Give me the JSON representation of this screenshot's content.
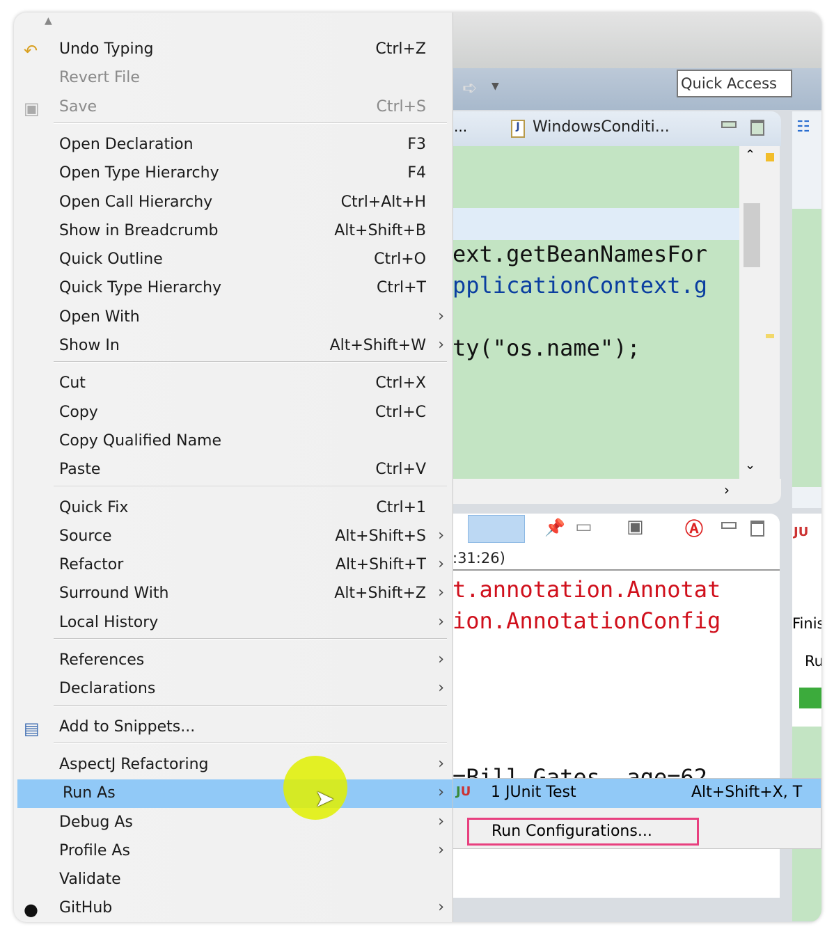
{
  "window": {
    "quick_access": "Quick Access",
    "editor_tab": "WindowsConditi...",
    "editor_tab_overflow": "..."
  },
  "editor": {
    "lines": [
      "ext.getBeanNamesFor",
      "pplicationContext.g",
      "ty(\"os.name\");"
    ]
  },
  "console": {
    "header": ":31:26)",
    "lines": [
      "t.annotation.Annotat",
      "ion.AnnotationConfig",
      "=Bill Gates, age=62"
    ]
  },
  "junit": {
    "finished": "Finis",
    "runs": "Ru",
    "status_color": "#3cab3c"
  },
  "menu": {
    "items": [
      {
        "label": "Undo Typing",
        "shortcut": "Ctrl+Z",
        "icon": "undo-icon"
      },
      {
        "label": "Revert File",
        "disabled": true
      },
      {
        "label": "Save",
        "shortcut": "Ctrl+S",
        "disabled": true,
        "icon": "save-icon",
        "sep_after": true
      },
      {
        "label": "Open Declaration",
        "shortcut": "F3"
      },
      {
        "label": "Open Type Hierarchy",
        "shortcut": "F4"
      },
      {
        "label": "Open Call Hierarchy",
        "shortcut": "Ctrl+Alt+H"
      },
      {
        "label": "Show in Breadcrumb",
        "shortcut": "Alt+Shift+B"
      },
      {
        "label": "Quick Outline",
        "shortcut": "Ctrl+O"
      },
      {
        "label": "Quick Type Hierarchy",
        "shortcut": "Ctrl+T"
      },
      {
        "label": "Open With",
        "submenu": true
      },
      {
        "label": "Show In",
        "shortcut": "Alt+Shift+W",
        "submenu": true,
        "sep_after": true
      },
      {
        "label": "Cut",
        "shortcut": "Ctrl+X"
      },
      {
        "label": "Copy",
        "shortcut": "Ctrl+C"
      },
      {
        "label": "Copy Qualified Name"
      },
      {
        "label": "Paste",
        "shortcut": "Ctrl+V",
        "sep_after": true
      },
      {
        "label": "Quick Fix",
        "shortcut": "Ctrl+1"
      },
      {
        "label": "Source",
        "shortcut": "Alt+Shift+S",
        "submenu": true
      },
      {
        "label": "Refactor",
        "shortcut": "Alt+Shift+T",
        "submenu": true
      },
      {
        "label": "Surround With",
        "shortcut": "Alt+Shift+Z",
        "submenu": true
      },
      {
        "label": "Local History",
        "submenu": true,
        "sep_after": true
      },
      {
        "label": "References",
        "submenu": true
      },
      {
        "label": "Declarations",
        "submenu": true,
        "sep_after": true
      },
      {
        "label": "Add to Snippets...",
        "icon": "snippets-icon",
        "sep_after": true
      },
      {
        "label": "AspectJ Refactoring",
        "submenu": true
      },
      {
        "label": "Run As",
        "submenu": true,
        "highlighted": true
      },
      {
        "label": "Debug As",
        "submenu": true
      },
      {
        "label": "Profile As",
        "submenu": true
      },
      {
        "label": "Validate"
      },
      {
        "label": "GitHub",
        "submenu": true,
        "icon": "github-icon"
      }
    ]
  },
  "submenu": {
    "items": [
      {
        "label": "1 JUnit Test",
        "shortcut": "Alt+Shift+X, T",
        "icon": "junit-icon",
        "highlighted": true
      },
      {
        "label": "Run Configurations...",
        "annotated": true
      }
    ]
  },
  "colors": {
    "highlight": "#91c9f7",
    "annotation_box": "#e8407f",
    "editor_bg": "#c3e4c3"
  }
}
